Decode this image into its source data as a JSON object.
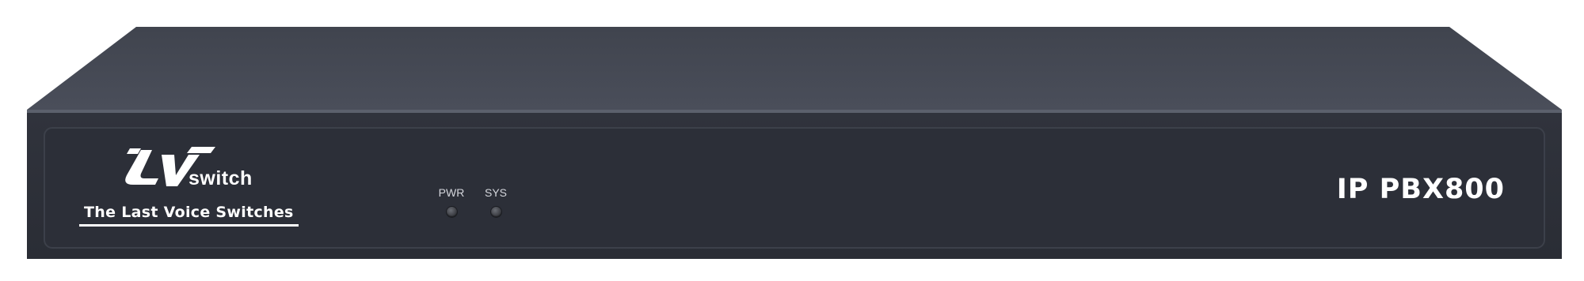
{
  "device": {
    "brand": {
      "logo_letters": "LV",
      "logo_suffix": "switch",
      "tagline": "The Last Voice Switches"
    },
    "indicators": [
      {
        "label": "PWR",
        "state": "off"
      },
      {
        "label": "SYS",
        "state": "off"
      }
    ],
    "model": "IP PBX800"
  },
  "colors": {
    "top_surface": "#464b57",
    "front_panel": "#2d3039",
    "text": "#ffffff",
    "background": "#ffffff"
  }
}
